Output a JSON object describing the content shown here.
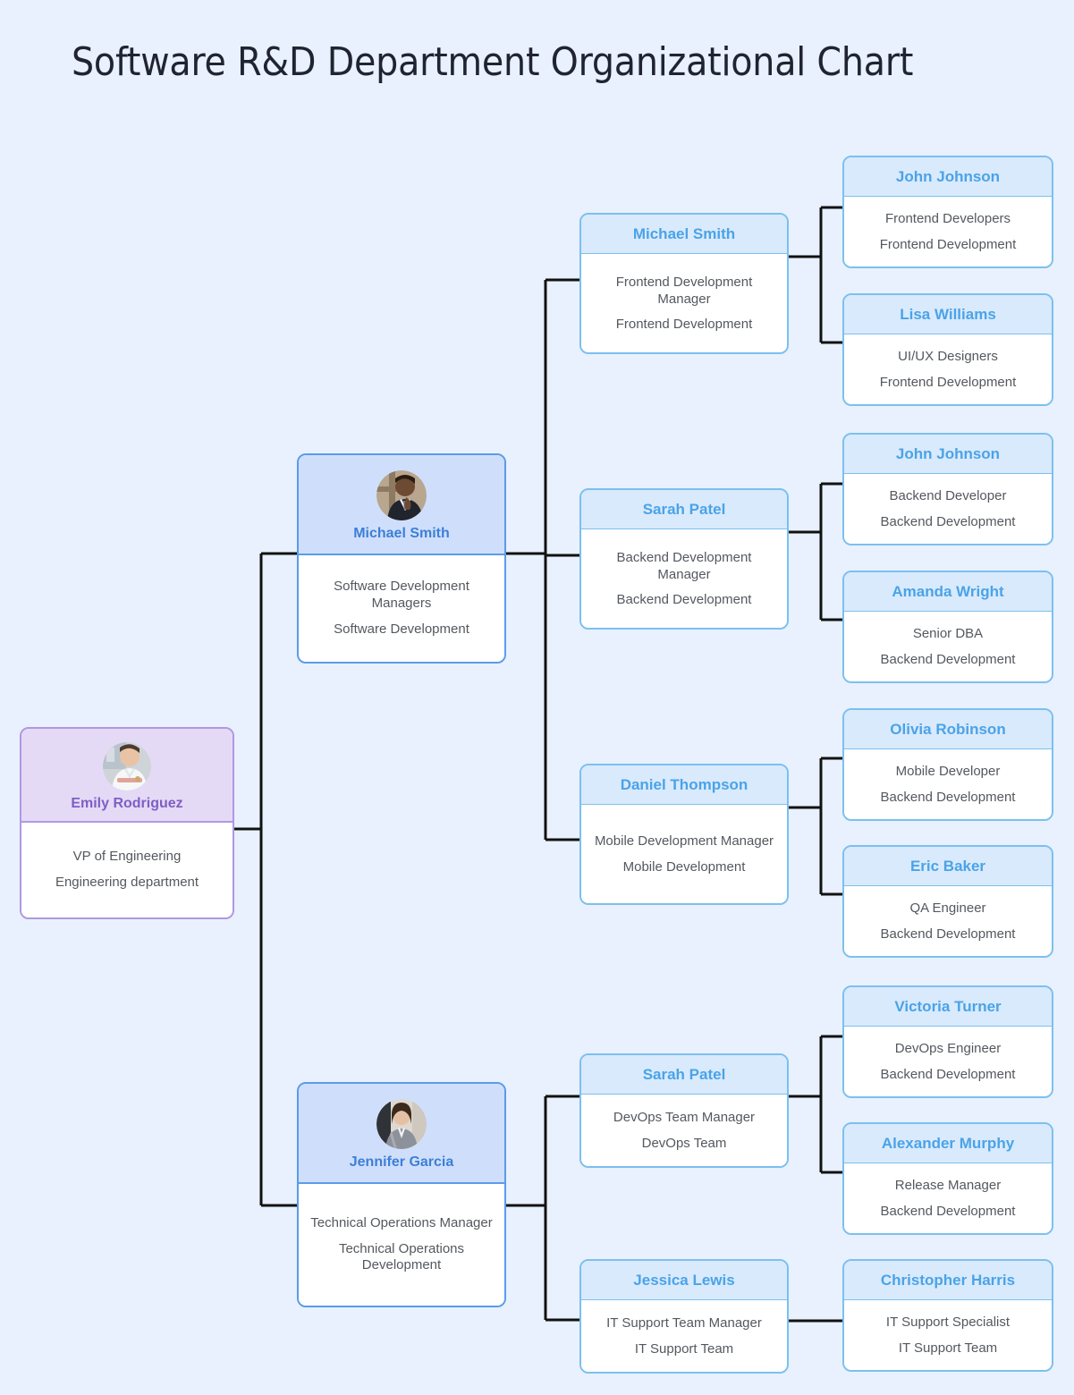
{
  "page": {
    "title": "Software R&D Department Organizational Chart",
    "background_color": "#e8f1fd"
  },
  "theme": {
    "root_accent": "#7f5ec4",
    "root_header_bg": "#e4daf6",
    "root_border": "#b197e0",
    "level1_accent": "#3d7fd6",
    "level1_header_bg": "#cfdffb",
    "level1_border": "#5a9bea",
    "leaf_accent": "#4aa3e8",
    "leaf_header_bg": "#d9eafc",
    "leaf_border": "#7cc0ee",
    "connector_color": "#111111",
    "body_text_color": "#54585e"
  },
  "chart_data": {
    "type": "diagram",
    "diagram_kind": "organizational-chart",
    "orientation": "left-to-right",
    "title": "Software R&D Department Organizational Chart",
    "levels": 4,
    "node_count": 16,
    "nodes": [
      {
        "id": "n0",
        "level": 0,
        "name": "Emily Rodriguez",
        "role": "VP of Engineering",
        "department": "Engineering department",
        "has_avatar": true,
        "avatar_name": "emily-rodriguez-avatar",
        "parent": null
      },
      {
        "id": "n1",
        "level": 1,
        "name": "Michael Smith",
        "role": "Software Development Managers",
        "department": "Software Development",
        "has_avatar": true,
        "avatar_name": "michael-smith-avatar",
        "parent": "n0"
      },
      {
        "id": "n2",
        "level": 1,
        "name": "Jennifer Garcia",
        "role": "Technical Operations Manager",
        "department": "Technical Operations Development",
        "has_avatar": true,
        "avatar_name": "jennifer-garcia-avatar",
        "parent": "n0"
      },
      {
        "id": "n3",
        "level": 2,
        "name": "Michael Smith",
        "role": "Frontend Development Manager",
        "department": "Frontend Development",
        "has_avatar": false,
        "parent": "n1"
      },
      {
        "id": "n4",
        "level": 2,
        "name": "Sarah Patel",
        "role": "Backend Development Manager",
        "department": "Backend Development",
        "has_avatar": false,
        "parent": "n1"
      },
      {
        "id": "n5",
        "level": 2,
        "name": "Daniel Thompson",
        "role": "Mobile Development Manager",
        "department": "Mobile Development",
        "has_avatar": false,
        "parent": "n1"
      },
      {
        "id": "n6",
        "level": 2,
        "name": "Sarah Patel",
        "role": "DevOps Team Manager",
        "department": "DevOps Team",
        "has_avatar": false,
        "parent": "n2"
      },
      {
        "id": "n7",
        "level": 2,
        "name": "Jessica Lewis",
        "role": "IT Support Team Manager",
        "department": "IT Support Team",
        "has_avatar": false,
        "parent": "n2"
      },
      {
        "id": "n8",
        "level": 3,
        "name": "John Johnson",
        "role": "Frontend Developers",
        "department": "Frontend Development",
        "has_avatar": false,
        "parent": "n3"
      },
      {
        "id": "n9",
        "level": 3,
        "name": "Lisa Williams",
        "role": "UI/UX Designers",
        "department": "Frontend Development",
        "has_avatar": false,
        "parent": "n3"
      },
      {
        "id": "n10",
        "level": 3,
        "name": "John Johnson",
        "role": "Backend Developer",
        "department": "Backend Development",
        "has_avatar": false,
        "parent": "n4"
      },
      {
        "id": "n11",
        "level": 3,
        "name": "Amanda Wright",
        "role": "Senior DBA",
        "department": "Backend Development",
        "has_avatar": false,
        "parent": "n4"
      },
      {
        "id": "n12",
        "level": 3,
        "name": "Olivia Robinson",
        "role": "Mobile Developer",
        "department": "Backend Development",
        "has_avatar": false,
        "parent": "n5"
      },
      {
        "id": "n13",
        "level": 3,
        "name": "Eric Baker",
        "role": "QA Engineer",
        "department": "Backend Development",
        "has_avatar": false,
        "parent": "n5"
      },
      {
        "id": "n14",
        "level": 3,
        "name": "Victoria Turner",
        "role": "DevOps Engineer",
        "department": "Backend Development",
        "has_avatar": false,
        "parent": "n6"
      },
      {
        "id": "n15",
        "level": 3,
        "name": "Alexander Murphy",
        "role": "Release Manager",
        "department": "Backend Development",
        "has_avatar": false,
        "parent": "n6"
      },
      {
        "id": "n16",
        "level": 3,
        "name": "Christopher Harris",
        "role": "IT Support Specialist",
        "department": "IT Support Team",
        "has_avatar": false,
        "parent": "n7"
      }
    ]
  }
}
